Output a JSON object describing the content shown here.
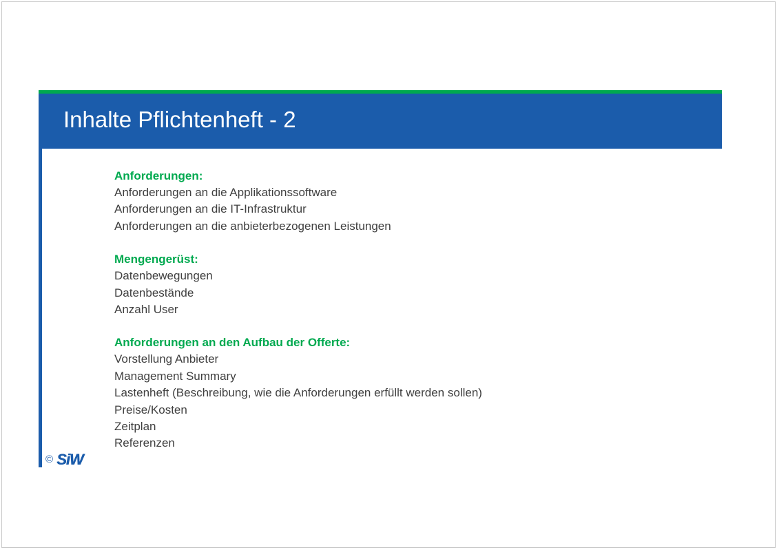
{
  "slide": {
    "title": "Inhalte Pflichtenheft - 2",
    "colors": {
      "title_bar": "#1b5cab",
      "accent_green": "#00a94f",
      "body_text": "#404040"
    },
    "sections": [
      {
        "heading": "Anforderungen:",
        "items": [
          "Anforderungen an die Applikationssoftware",
          "Anforderungen an die IT-Infrastruktur",
          "Anforderungen an die anbieterbezogenen Leistungen"
        ]
      },
      {
        "heading": "Mengengerüst:",
        "items": [
          "Datenbewegungen",
          "Datenbestände",
          "Anzahl User"
        ]
      },
      {
        "heading": "Anforderungen an den Aufbau der Offerte:",
        "items": [
          "Vorstellung Anbieter",
          "Management Summary",
          "Lastenheft (Beschreibung, wie die Anforderungen erfüllt werden sollen)",
          "Preise/Kosten",
          "Zeitplan",
          "Referenzen"
        ]
      }
    ],
    "footer": {
      "copyright_symbol": "©",
      "logo_text": "SiW"
    }
  }
}
